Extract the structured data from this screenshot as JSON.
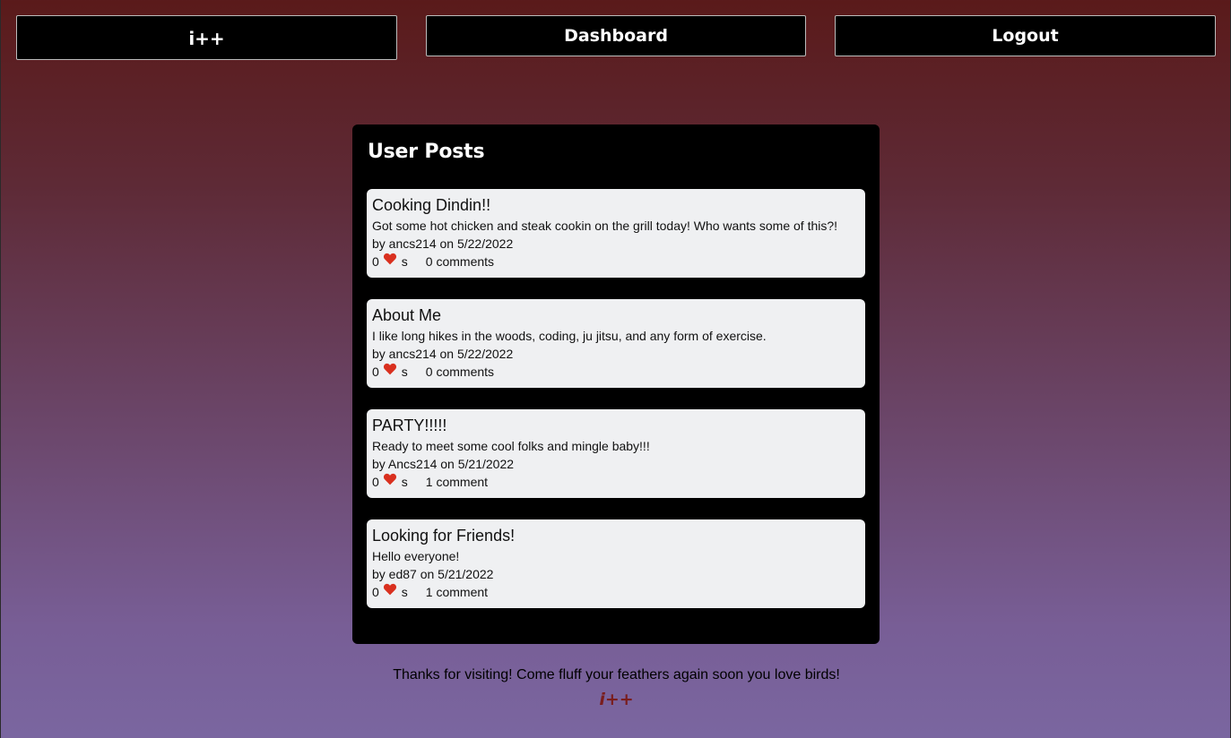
{
  "nav": {
    "home_label": "i++",
    "dashboard_label": "Dashboard",
    "logout_label": "Logout"
  },
  "panel": {
    "title": "User Posts"
  },
  "posts": [
    {
      "title": "Cooking Dindin!!",
      "body": "Got some hot chicken and steak cookin on the grill today! Who wants some of this?!",
      "meta": "by ancs214 on 5/22/2022",
      "likes": "0",
      "likes_suffix": "s",
      "comments": "0 comments"
    },
    {
      "title": "About Me",
      "body": "I like long hikes in the woods, coding, ju jitsu, and any form of exercise.",
      "meta": "by ancs214 on 5/22/2022",
      "likes": "0",
      "likes_suffix": "s",
      "comments": "0 comments"
    },
    {
      "title": "PARTY!!!!!",
      "body": "Ready to meet some cool folks and mingle baby!!!",
      "meta": "by Ancs214 on 5/21/2022",
      "likes": "0",
      "likes_suffix": "s",
      "comments": "1 comment"
    },
    {
      "title": "Looking for Friends!",
      "body": "Hello everyone!",
      "meta": "by ed87 on 5/21/2022",
      "likes": "0",
      "likes_suffix": "s",
      "comments": "1 comment"
    }
  ],
  "footer": {
    "message": "Thanks for visiting! Come fluff your feathers again soon you love birds!",
    "logo": "i++"
  },
  "icons": {
    "like": "heart-icon"
  },
  "colors": {
    "heart": "#d9301f",
    "footer_logo": "#7a1d1d"
  }
}
